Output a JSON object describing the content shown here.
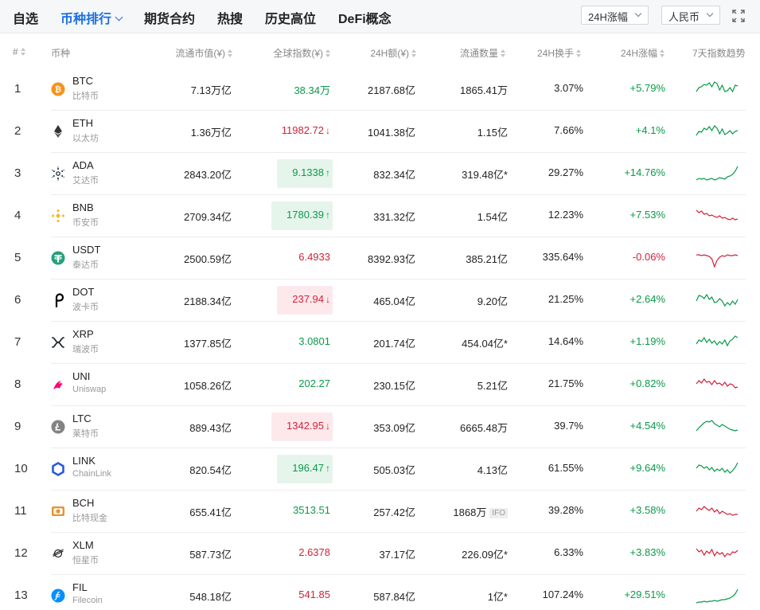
{
  "tabs": [
    {
      "label": "自选",
      "active": false
    },
    {
      "label": "币种排行",
      "active": true
    },
    {
      "label": "期货合约",
      "active": false
    },
    {
      "label": "热搜",
      "active": false
    },
    {
      "label": "历史高位",
      "active": false
    },
    {
      "label": "DeFi概念",
      "active": false
    }
  ],
  "filters": {
    "range": "24H涨幅",
    "currency": "人民币"
  },
  "columns": {
    "rank": "#",
    "coin": "币种",
    "market_cap": "流通市值(¥)",
    "index": "全球指数(¥)",
    "volume": "24H额(¥)",
    "supply": "流通数量",
    "turnover": "24H换手",
    "change": "24H涨幅",
    "trend": "7天指数趋势"
  },
  "colors": {
    "up": "#0a9a4a",
    "down": "#d4213a",
    "active_tab": "#1b6fe0"
  },
  "coins": [
    {
      "rank": "1",
      "symbol": "BTC",
      "name": "比特币",
      "icon": "btc-icon",
      "market_cap": "7.13万亿",
      "index": "38.34万",
      "flash": "",
      "index_color": "green",
      "volume": "2187.68亿",
      "supply": "1865.41万",
      "supply_tag": "",
      "turnover": "3.07%",
      "change": "+5.79%",
      "trend": [
        14,
        9,
        8,
        5,
        6,
        3,
        8,
        2,
        4,
        12,
        6,
        14,
        13,
        9,
        14,
        6,
        7
      ]
    },
    {
      "rank": "2",
      "symbol": "ETH",
      "name": "以太坊",
      "icon": "eth-icon",
      "market_cap": "1.36万亿",
      "index": "11982.72",
      "flash": "down-text",
      "index_color": "red",
      "volume": "1041.38亿",
      "supply": "1.15亿",
      "supply_tag": "",
      "turnover": "7.66%",
      "change": "+4.1%",
      "trend": [
        16,
        11,
        12,
        7,
        9,
        5,
        10,
        4,
        7,
        14,
        8,
        15,
        13,
        10,
        14,
        11,
        10
      ]
    },
    {
      "rank": "3",
      "symbol": "ADA",
      "name": "艾达币",
      "icon": "ada-icon",
      "market_cap": "2843.20亿",
      "index": "9.1338",
      "flash": "up",
      "index_color": "green",
      "volume": "832.34亿",
      "supply": "319.48亿*",
      "supply_tag": "",
      "turnover": "29.27%",
      "change": "+14.76%",
      "trend": [
        19,
        17,
        18,
        17,
        19,
        18,
        17,
        19,
        18,
        16,
        17,
        18,
        15,
        14,
        12,
        8,
        2
      ]
    },
    {
      "rank": "4",
      "symbol": "BNB",
      "name": "币安币",
      "icon": "bnb-icon",
      "market_cap": "2709.34亿",
      "index": "1780.39",
      "flash": "up",
      "index_color": "green",
      "volume": "331.32亿",
      "supply": "1.54亿",
      "supply_tag": "",
      "turnover": "12.23%",
      "change": "+7.53%",
      "trend": [
        4,
        7,
        5,
        9,
        8,
        11,
        10,
        12,
        13,
        11,
        14,
        13,
        15,
        16,
        14,
        16,
        15
      ]
    },
    {
      "rank": "5",
      "symbol": "USDT",
      "name": "泰达币",
      "icon": "usdt-icon",
      "market_cap": "2500.59亿",
      "index": "6.4933",
      "flash": "",
      "index_color": "red",
      "volume": "8392.93亿",
      "supply": "385.21亿",
      "supply_tag": "",
      "turnover": "335.64%",
      "change": "-0.06%",
      "trend": [
        7,
        7,
        8,
        7,
        8,
        9,
        12,
        22,
        14,
        10,
        8,
        9,
        7,
        8,
        8,
        7,
        8
      ]
    },
    {
      "rank": "6",
      "symbol": "DOT",
      "name": "波卡币",
      "icon": "dot-icon",
      "market_cap": "2188.34亿",
      "index": "237.94",
      "flash": "down",
      "index_color": "red",
      "volume": "465.04亿",
      "supply": "9.20亿",
      "supply_tag": "",
      "turnover": "21.25%",
      "change": "+2.64%",
      "trend": [
        12,
        5,
        6,
        9,
        4,
        10,
        7,
        14,
        13,
        9,
        12,
        18,
        14,
        17,
        12,
        16,
        10
      ]
    },
    {
      "rank": "7",
      "symbol": "XRP",
      "name": "瑞波币",
      "icon": "xrp-icon",
      "market_cap": "1377.85亿",
      "index": "3.0801",
      "flash": "",
      "index_color": "green",
      "volume": "201.74亿",
      "supply": "454.04亿*",
      "supply_tag": "",
      "turnover": "14.64%",
      "change": "+1.19%",
      "trend": [
        13,
        8,
        10,
        5,
        11,
        7,
        12,
        9,
        14,
        10,
        13,
        8,
        15,
        9,
        7,
        3,
        5
      ]
    },
    {
      "rank": "8",
      "symbol": "UNI",
      "name": "Uniswap",
      "icon": "uni-icon",
      "market_cap": "1058.26亿",
      "index": "202.27",
      "flash": "",
      "index_color": "green",
      "volume": "230.15亿",
      "supply": "5.21亿",
      "supply_tag": "",
      "turnover": "21.75%",
      "change": "+0.82%",
      "trend": [
        10,
        6,
        9,
        4,
        8,
        7,
        11,
        6,
        10,
        9,
        12,
        8,
        13,
        10,
        11,
        15,
        14
      ]
    },
    {
      "rank": "9",
      "symbol": "LTC",
      "name": "莱特币",
      "icon": "ltc-icon",
      "market_cap": "889.43亿",
      "index": "1342.95",
      "flash": "down",
      "index_color": "red",
      "volume": "353.09亿",
      "supply": "6665.48万",
      "supply_tag": "",
      "turnover": "39.7%",
      "change": "+4.54%",
      "trend": [
        16,
        12,
        9,
        6,
        4,
        5,
        3,
        7,
        9,
        11,
        8,
        10,
        12,
        14,
        15,
        16,
        15
      ]
    },
    {
      "rank": "10",
      "symbol": "LINK",
      "name": "ChainLink",
      "icon": "link-icon",
      "market_cap": "820.54亿",
      "index": "196.47",
      "flash": "up",
      "index_color": "green",
      "volume": "505.03亿",
      "supply": "4.13亿",
      "supply_tag": "",
      "turnover": "61.55%",
      "change": "+9.64%",
      "trend": [
        10,
        6,
        7,
        10,
        8,
        12,
        9,
        14,
        11,
        13,
        10,
        15,
        12,
        16,
        13,
        9,
        3
      ]
    },
    {
      "rank": "11",
      "symbol": "BCH",
      "name": "比特现金",
      "icon": "bch-icon",
      "market_cap": "655.41亿",
      "index": "3513.51",
      "flash": "",
      "index_color": "green",
      "volume": "257.42亿",
      "supply": "1868万",
      "supply_tag": "IFO",
      "turnover": "39.28%",
      "change": "+3.58%",
      "trend": [
        11,
        7,
        9,
        5,
        8,
        10,
        7,
        12,
        9,
        14,
        11,
        13,
        15,
        14,
        16,
        15,
        15
      ]
    },
    {
      "rank": "12",
      "symbol": "XLM",
      "name": "恒星币",
      "icon": "xlm-icon",
      "market_cap": "587.73亿",
      "index": "2.6378",
      "flash": "",
      "index_color": "red",
      "volume": "37.17亿",
      "supply": "226.09亿*",
      "supply_tag": "",
      "turnover": "6.33%",
      "change": "+3.83%",
      "trend": [
        5,
        9,
        7,
        13,
        8,
        11,
        6,
        14,
        9,
        12,
        10,
        15,
        11,
        13,
        9,
        10,
        7
      ]
    },
    {
      "rank": "13",
      "symbol": "FIL",
      "name": "Filecoin",
      "icon": "fil-icon",
      "market_cap": "548.18亿",
      "index": "541.85",
      "flash": "",
      "index_color": "red",
      "volume": "587.84亿",
      "supply": "1亿*",
      "supply_tag": "",
      "turnover": "107.24%",
      "change": "+29.51%",
      "trend": [
        20,
        19,
        19,
        18,
        19,
        18,
        18,
        17,
        18,
        17,
        16,
        16,
        15,
        14,
        12,
        9,
        3
      ]
    }
  ]
}
